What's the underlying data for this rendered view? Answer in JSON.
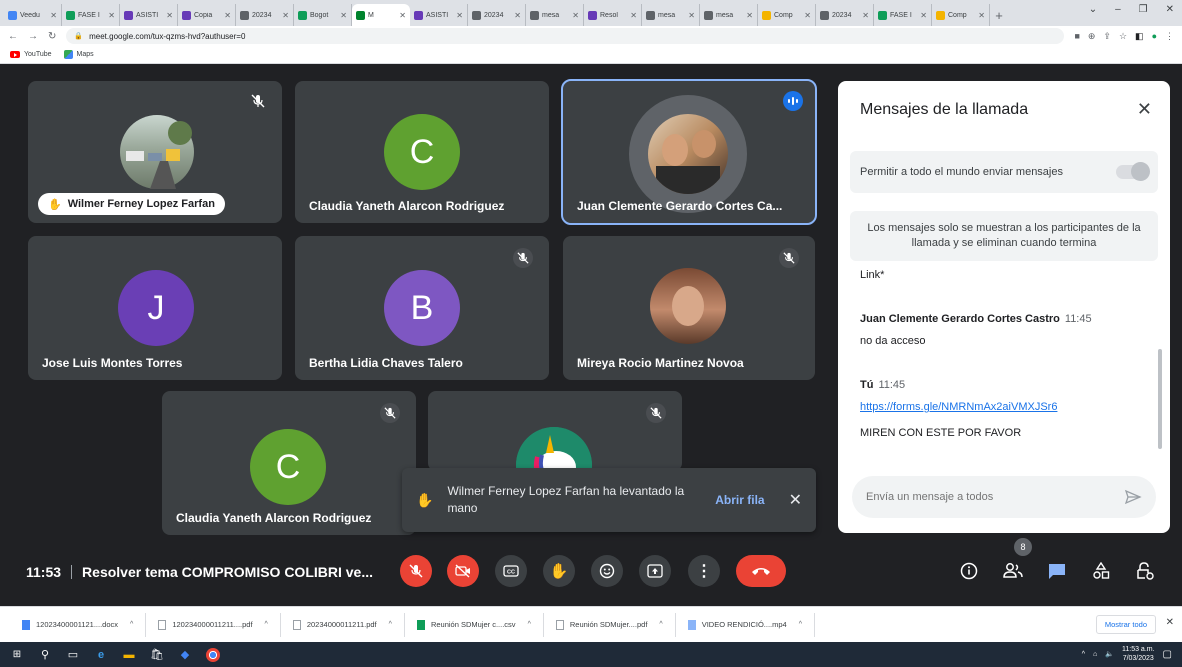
{
  "browser": {
    "tabs": [
      {
        "label": "Veedu",
        "color": "#4285f4"
      },
      {
        "label": "FASE I",
        "color": "#0f9d58"
      },
      {
        "label": "ASISTI",
        "color": "#673ab7"
      },
      {
        "label": "Copia",
        "color": "#673ab7"
      },
      {
        "label": "20234",
        "color": "#5f6368"
      },
      {
        "label": "Bogot",
        "color": "#0f9d58"
      },
      {
        "label": "M",
        "color": "#00832d",
        "active": true
      },
      {
        "label": "ASISTI",
        "color": "#673ab7"
      },
      {
        "label": "20234",
        "color": "#5f6368"
      },
      {
        "label": "mesa",
        "color": "#5f6368"
      },
      {
        "label": "Resol",
        "color": "#673ab7"
      },
      {
        "label": "mesa",
        "color": "#5f6368"
      },
      {
        "label": "mesa",
        "color": "#5f6368"
      },
      {
        "label": "Comp",
        "color": "#f4b400"
      },
      {
        "label": "20234",
        "color": "#5f6368"
      },
      {
        "label": "FASE I",
        "color": "#0f9d58"
      },
      {
        "label": "Comp",
        "color": "#f4b400"
      }
    ],
    "url": "meet.google.com/tux-qzms-hvd?authuser=0",
    "bookmarks": [
      "YouTube",
      "Maps"
    ]
  },
  "participants": [
    {
      "name": "Wilmer Ferney Lopez Farfan",
      "initial": "",
      "color": "#6d8f6a",
      "muted": true,
      "hand_raised": true
    },
    {
      "name": "Claudia Yaneth Alarcon Rodriguez",
      "initial": "C",
      "color": "#5fa130",
      "muted": false
    },
    {
      "name": "Juan Clemente Gerardo Cortes Ca...",
      "initial": "",
      "color": "#b08a6a",
      "speaking": true
    },
    {
      "name": "Jose Luis Montes Torres",
      "initial": "J",
      "color": "#6a3fb5"
    },
    {
      "name": "Bertha Lidia Chaves Talero",
      "initial": "B",
      "color": "#7e57c2",
      "muted": true
    },
    {
      "name": "Mireya Rocio Martinez Novoa",
      "initial": "",
      "color": "#8a5a44",
      "muted": true
    },
    {
      "name": "Claudia Yaneth Alarcon Rodriguez",
      "initial": "C",
      "color": "#5fa130",
      "muted": true
    },
    {
      "name": "",
      "initial": "",
      "color": "#1e8a6a",
      "muted": true
    }
  ],
  "toast": {
    "text": "Wilmer Ferney Lopez Farfan ha levantado la mano",
    "action": "Abrir fila"
  },
  "chat": {
    "title": "Mensajes de la llamada",
    "permission_label": "Permitir a todo el mundo enviar mensajes",
    "info": "Los mensajes solo se muestran a los participantes de la llamada y se eliminan cuando termina",
    "messages": [
      {
        "text": "Link*"
      },
      {
        "sender": "Juan Clemente Gerardo Cortes Castro",
        "time": "11:45",
        "text": "no da acceso"
      },
      {
        "sender": "Tú",
        "time": "11:45",
        "link": "https://forms.gle/NMRNmAx2aiVMXJSr6",
        "text": "MIREN CON ESTE POR FAVOR"
      }
    ],
    "placeholder": "Envía un mensaje a todos"
  },
  "controls": {
    "time": "11:53",
    "meeting_title": "Resolver tema COMPROMISO COLIBRI ve...",
    "participant_count": "8"
  },
  "downloads": {
    "items": [
      {
        "name": "12023400001121....docx",
        "type": "docx"
      },
      {
        "name": "120234000011211....pdf",
        "type": "pdf"
      },
      {
        "name": "20234000011211.pdf",
        "type": "pdf"
      },
      {
        "name": "Reunión SDMujer c....csv",
        "type": "csv"
      },
      {
        "name": "Reunión SDMujer....pdf",
        "type": "pdf"
      },
      {
        "name": "VIDEO RENDICIÓ....mp4",
        "type": "mp4"
      }
    ],
    "show_all": "Mostrar todo"
  },
  "taskbar": {
    "time": "11:53 a.m.",
    "date": "7/03/2023"
  }
}
